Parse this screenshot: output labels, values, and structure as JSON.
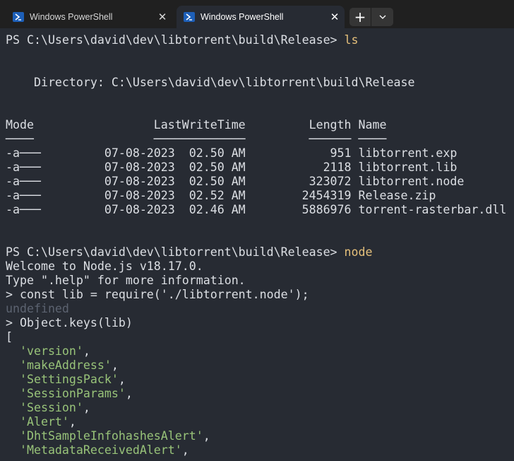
{
  "tabs": [
    {
      "title": "Windows PowerShell",
      "active": false
    },
    {
      "title": "Windows PowerShell",
      "active": true
    }
  ],
  "tabbar": {
    "close_glyph": "✕",
    "new_tab_glyph": "+",
    "dropdown_glyph": "⌄"
  },
  "terminal": {
    "prompt1": "PS C:\\Users\\david\\dev\\libtorrent\\build\\Release> ",
    "command1": "ls",
    "directory_line": "    Directory: C:\\Users\\david\\dev\\libtorrent\\build\\Release",
    "header_line": "Mode                 LastWriteTime         Length Name",
    "underline_line": "────                 ─────────────         ────── ────",
    "files": [
      {
        "mode": "-a───",
        "date": "07-08-2023",
        "time": "02.50 AM",
        "length": "951",
        "name": "libtorrent.exp"
      },
      {
        "mode": "-a───",
        "date": "07-08-2023",
        "time": "02.50 AM",
        "length": "2118",
        "name": "libtorrent.lib"
      },
      {
        "mode": "-a───",
        "date": "07-08-2023",
        "time": "02.50 AM",
        "length": "323072",
        "name": "libtorrent.node"
      },
      {
        "mode": "-a───",
        "date": "07-08-2023",
        "time": "02.52 AM",
        "length": "2454319",
        "name": "Release.zip"
      },
      {
        "mode": "-a───",
        "date": "07-08-2023",
        "time": "02.46 AM",
        "length": "5886976",
        "name": "torrent-rasterbar.dll"
      }
    ],
    "prompt2": "PS C:\\Users\\david\\dev\\libtorrent\\build\\Release> ",
    "command2": "node",
    "node_welcome": "Welcome to Node.js v18.17.0.",
    "node_help": "Type \".help\" for more information.",
    "repl_line1": "> const lib = require('./libtorrent.node');",
    "undefined_output": "undefined",
    "repl_line2": "> Object.keys(lib)",
    "array_open": "[",
    "keys": [
      "'version'",
      "'makeAddress'",
      "'SettingsPack'",
      "'SessionParams'",
      "'Session'",
      "'Alert'",
      "'DhtSampleInfohashesAlert'",
      "'MetadataReceivedAlert'"
    ]
  },
  "colors": {
    "terminal_bg": "#272b33",
    "tabbar_bg": "#202020",
    "text": "#dcdfe4",
    "command": "#e5c07b",
    "string": "#98c379",
    "dim": "#5c6370"
  }
}
